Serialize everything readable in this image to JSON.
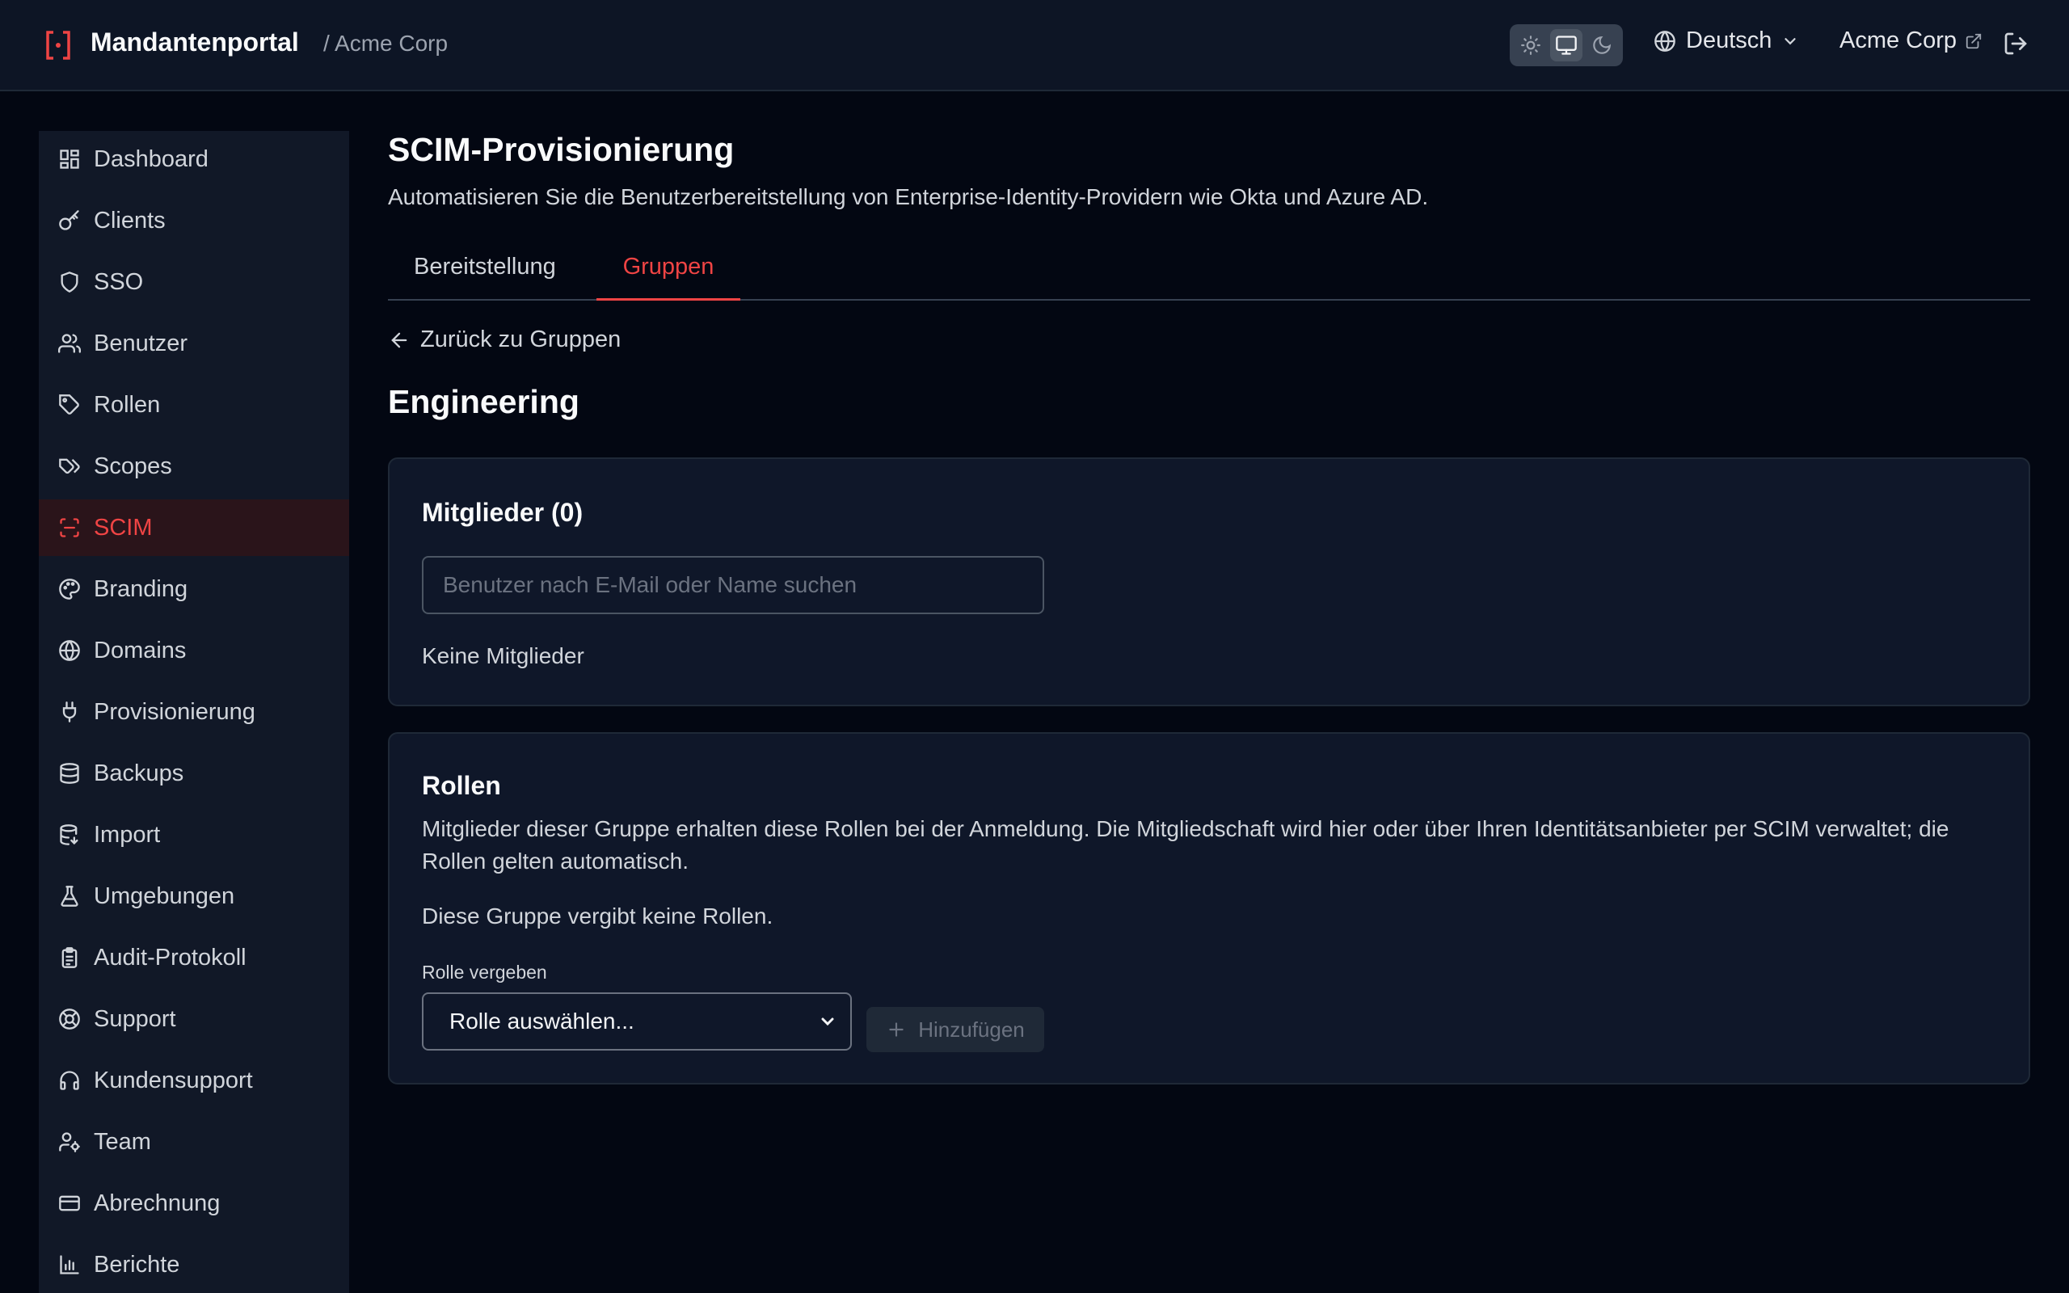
{
  "header": {
    "brand": "Mandantenportal",
    "breadcrumb": "/ Acme Corp",
    "language": "Deutsch",
    "tenant_link": "Acme Corp"
  },
  "sidebar": {
    "items": [
      {
        "label": "Dashboard",
        "icon": "dashboard-icon"
      },
      {
        "label": "Clients",
        "icon": "key-icon"
      },
      {
        "label": "SSO",
        "icon": "shield-icon"
      },
      {
        "label": "Benutzer",
        "icon": "users-icon"
      },
      {
        "label": "Rollen",
        "icon": "tag-icon"
      },
      {
        "label": "Scopes",
        "icon": "tags-icon"
      },
      {
        "label": "SCIM",
        "icon": "scan-icon"
      },
      {
        "label": "Branding",
        "icon": "palette-icon"
      },
      {
        "label": "Domains",
        "icon": "globe-icon"
      },
      {
        "label": "Provisionierung",
        "icon": "plug-icon"
      },
      {
        "label": "Backups",
        "icon": "database-icon"
      },
      {
        "label": "Import",
        "icon": "database-import-icon"
      },
      {
        "label": "Umgebungen",
        "icon": "flask-icon"
      },
      {
        "label": "Audit-Protokoll",
        "icon": "clipboard-icon"
      },
      {
        "label": "Support",
        "icon": "lifebuoy-icon"
      },
      {
        "label": "Kundensupport",
        "icon": "headset-icon"
      },
      {
        "label": "Team",
        "icon": "user-cog-icon"
      },
      {
        "label": "Abrechnung",
        "icon": "credit-card-icon"
      },
      {
        "label": "Berichte",
        "icon": "bar-chart-icon"
      }
    ],
    "active": "SCIM"
  },
  "page": {
    "title": "SCIM-Provisionierung",
    "subtitle": "Automatisieren Sie die Benutzerbereitstellung von Enterprise-Identity-Providern wie Okta und Azure AD.",
    "tabs": [
      {
        "label": "Bereitstellung"
      },
      {
        "label": "Gruppen"
      }
    ],
    "active_tab": "Gruppen",
    "back_label": "Zurück zu Gruppen",
    "group_name": "Engineering"
  },
  "members": {
    "title": "Mitglieder (0)",
    "search_placeholder": "Benutzer nach E-Mail oder Name suchen",
    "empty": "Keine Mitglieder"
  },
  "roles": {
    "title": "Rollen",
    "description": "Mitglieder dieser Gruppe erhalten diese Rollen bei der Anmeldung. Die Mitgliedschaft wird hier oder über Ihren Identitätsanbieter per SCIM verwaltet; die Rollen gelten automatisch.",
    "empty": "Diese Gruppe vergibt keine Rollen.",
    "assign_label": "Rolle vergeben",
    "select_value": "Rolle auswählen...",
    "add_button": "Hinzufügen"
  },
  "colors": {
    "accent": "#ef4444",
    "background": "#030712",
    "surface": "#111827"
  }
}
